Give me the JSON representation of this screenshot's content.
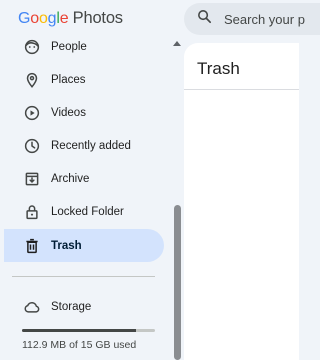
{
  "header": {
    "logo_letters": [
      {
        "char": "G",
        "color": "#4285F4"
      },
      {
        "char": "o",
        "color": "#EA4335"
      },
      {
        "char": "o",
        "color": "#FBBC05"
      },
      {
        "char": "g",
        "color": "#4285F4"
      },
      {
        "char": "l",
        "color": "#34A853"
      },
      {
        "char": "e",
        "color": "#EA4335"
      }
    ],
    "app_name": "Photos",
    "search": {
      "placeholder": "Search your p",
      "icon": "search-icon"
    }
  },
  "sidebar": {
    "items": [
      {
        "label": "People",
        "icon": "people-face-icon",
        "active": false
      },
      {
        "label": "Places",
        "icon": "location-pin-icon",
        "active": false
      },
      {
        "label": "Videos",
        "icon": "play-circle-icon",
        "active": false
      },
      {
        "label": "Recently added",
        "icon": "clock-icon",
        "active": false
      },
      {
        "label": "Archive",
        "icon": "archive-icon",
        "active": false
      },
      {
        "label": "Locked Folder",
        "icon": "lock-icon",
        "active": false
      },
      {
        "label": "Trash",
        "icon": "trash-icon",
        "active": true
      }
    ],
    "storage": {
      "label": "Storage",
      "icon": "cloud-icon",
      "used_fraction": 0.86,
      "usage_text": "112.9 MB of 15 GB used"
    }
  },
  "main": {
    "title": "Trash"
  },
  "colors": {
    "background": "#f0f4f9",
    "active_item": "#d3e3fd",
    "accent_text": "#001d35"
  }
}
